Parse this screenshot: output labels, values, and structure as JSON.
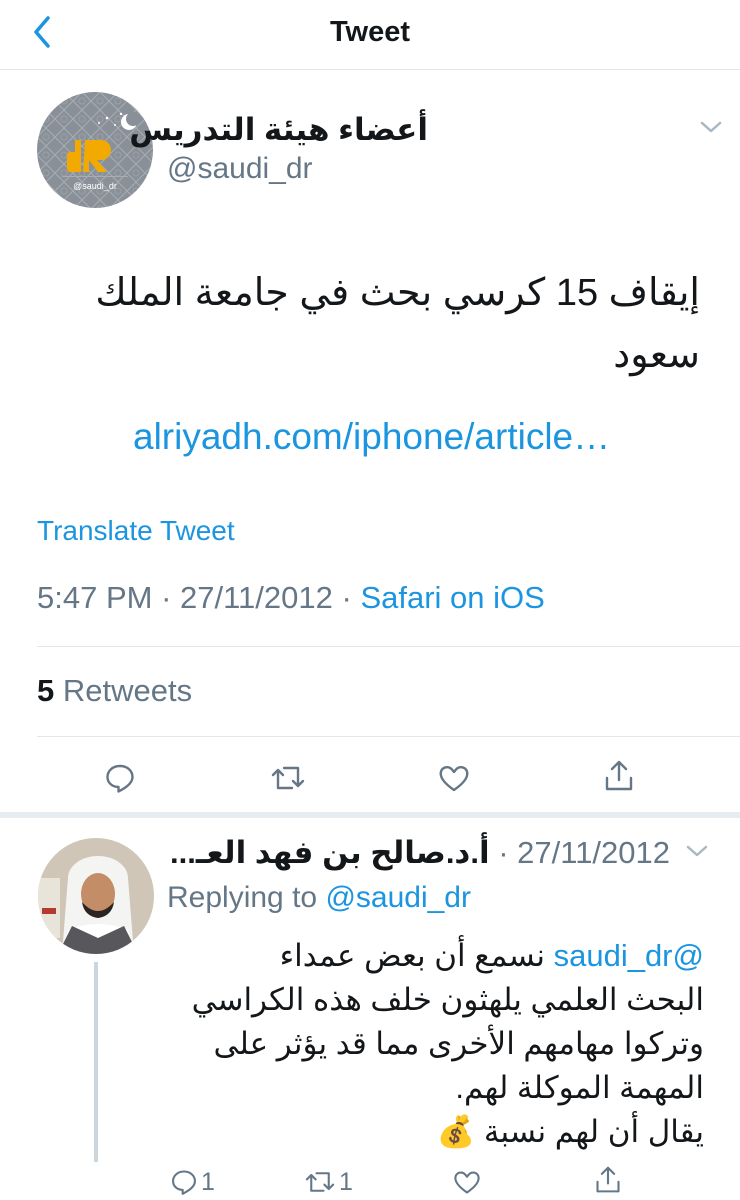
{
  "nav": {
    "title": "Tweet"
  },
  "tweet": {
    "author_name": "أعضاء هيئة التدريس",
    "author_handle": "@saudi_dr",
    "avatar_label": "@saudi_dr",
    "text": "إيقاف 15 كرسي بحث في جامعة الملك سعود",
    "link": "alriyadh.com/iphone/article…",
    "translate_label": "Translate Tweet",
    "time": "5:47 PM",
    "date": "27/11/2012",
    "source": "Safari on iOS",
    "retweet_count": "5",
    "retweet_label": "Retweets"
  },
  "reply": {
    "author_name": "أ.د.صالح بن فهد العـ...",
    "date": "27/11/2012",
    "replying_prefix": "Replying to",
    "replying_handle": "@saudi_dr",
    "mention": "@saudi_dr",
    "line1": "نسمع أن بعض عمداء",
    "line2": "البحث العلمي يلهثون خلف هذه الكراسي",
    "line3": "وتركوا مهامهم الأخرى مما قد يؤثر على",
    "line4": "المهمة الموكلة لهم.",
    "line5": "يقال أن لهم نسبة",
    "line5_emoji": "💰",
    "reply_count": "1",
    "retweet_count": "1"
  },
  "colors": {
    "accent": "#1b95e0",
    "muted": "#657786",
    "text": "#14171a",
    "divider": "#e1e8ed"
  },
  "icons": [
    "back-chevron-icon",
    "caret-down-icon",
    "reply-icon",
    "retweet-icon",
    "like-icon",
    "share-icon"
  ]
}
